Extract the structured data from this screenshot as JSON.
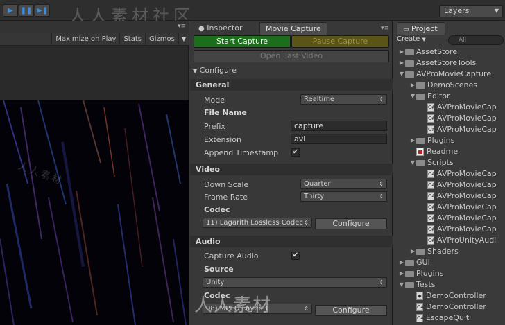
{
  "toolbar": {
    "play_icons": [
      "play-icon",
      "pause-icon",
      "step-icon"
    ],
    "watermark": "人人素材社区",
    "layers_label": "Layers"
  },
  "game": {
    "toolbar_items": [
      "Maximize on Play",
      "Stats",
      "Gizmos"
    ]
  },
  "capture": {
    "tabs": [
      "Inspector",
      "Movie Capture"
    ],
    "start_label": "Start Capture",
    "pause_label": "Pause Capture",
    "open_last_label": "Open Last Video",
    "configure_label": "Configure",
    "general": {
      "header": "General",
      "mode_label": "Mode",
      "mode_value": "Realtime",
      "filename_header": "File Name",
      "prefix_label": "Prefix",
      "prefix_value": "capture",
      "extension_label": "Extension",
      "extension_value": "avi",
      "append_label": "Append Timestamp",
      "append_checked": "✔"
    },
    "video": {
      "header": "Video",
      "downscale_label": "Down Scale",
      "downscale_value": "Quarter",
      "framerate_label": "Frame Rate",
      "framerate_value": "Thirty",
      "codec_header": "Codec",
      "codec_value": "11) Lagarith Lossless Codec",
      "configure_btn": "Configure"
    },
    "audio": {
      "header": "Audio",
      "capture_label": "Capture Audio",
      "capture_checked": "✔",
      "source_header": "Source",
      "source_value": "Unity",
      "codec_header": "Codec",
      "codec_value": "08) MPEG Layer-3",
      "configure_btn": "Configure"
    },
    "watermark": "人人素材"
  },
  "project": {
    "tab_label": "Project",
    "create_label": "Create",
    "search_placeholder": "All",
    "tree": [
      {
        "label": "AssetStore",
        "type": "folder",
        "level": 0,
        "expand": "▶"
      },
      {
        "label": "AssetStoreTools",
        "type": "folder",
        "level": 0,
        "expand": "▶"
      },
      {
        "label": "AVProMovieCapture",
        "type": "folder",
        "level": 0,
        "expand": "▼"
      },
      {
        "label": "DemoScenes",
        "type": "folder",
        "level": 1,
        "expand": "▶"
      },
      {
        "label": "Editor",
        "type": "folder",
        "level": 1,
        "expand": "▼"
      },
      {
        "label": "AVProMovieCap",
        "type": "file",
        "level": 2,
        "expand": ""
      },
      {
        "label": "AVProMovieCap",
        "type": "file",
        "level": 2,
        "expand": ""
      },
      {
        "label": "AVProMovieCap",
        "type": "file",
        "level": 2,
        "expand": ""
      },
      {
        "label": "Plugins",
        "type": "folder",
        "level": 1,
        "expand": "▶"
      },
      {
        "label": "Readme",
        "type": "pdf",
        "level": 1,
        "expand": ""
      },
      {
        "label": "Scripts",
        "type": "folder",
        "level": 1,
        "expand": "▼"
      },
      {
        "label": "AVProMovieCap",
        "type": "file",
        "level": 2,
        "expand": ""
      },
      {
        "label": "AVProMovieCap",
        "type": "file",
        "level": 2,
        "expand": ""
      },
      {
        "label": "AVProMovieCap",
        "type": "file",
        "level": 2,
        "expand": ""
      },
      {
        "label": "AVProMovieCap",
        "type": "file",
        "level": 2,
        "expand": ""
      },
      {
        "label": "AVProMovieCap",
        "type": "file",
        "level": 2,
        "expand": ""
      },
      {
        "label": "AVProMovieCap",
        "type": "file",
        "level": 2,
        "expand": ""
      },
      {
        "label": "AVProUnityAudi",
        "type": "file",
        "level": 2,
        "expand": ""
      },
      {
        "label": "Shaders",
        "type": "folder",
        "level": 1,
        "expand": "▶"
      },
      {
        "label": "GUI",
        "type": "folder",
        "level": 0,
        "expand": "▶"
      },
      {
        "label": "Plugins",
        "type": "folder",
        "level": 0,
        "expand": "▶"
      },
      {
        "label": "Tests",
        "type": "folder",
        "level": 0,
        "expand": "▼"
      },
      {
        "label": "DemoController",
        "type": "scene",
        "level": 1,
        "expand": ""
      },
      {
        "label": "DemoController",
        "type": "file",
        "level": 1,
        "expand": ""
      },
      {
        "label": "EscapeQuit",
        "type": "file",
        "level": 1,
        "expand": ""
      }
    ]
  }
}
